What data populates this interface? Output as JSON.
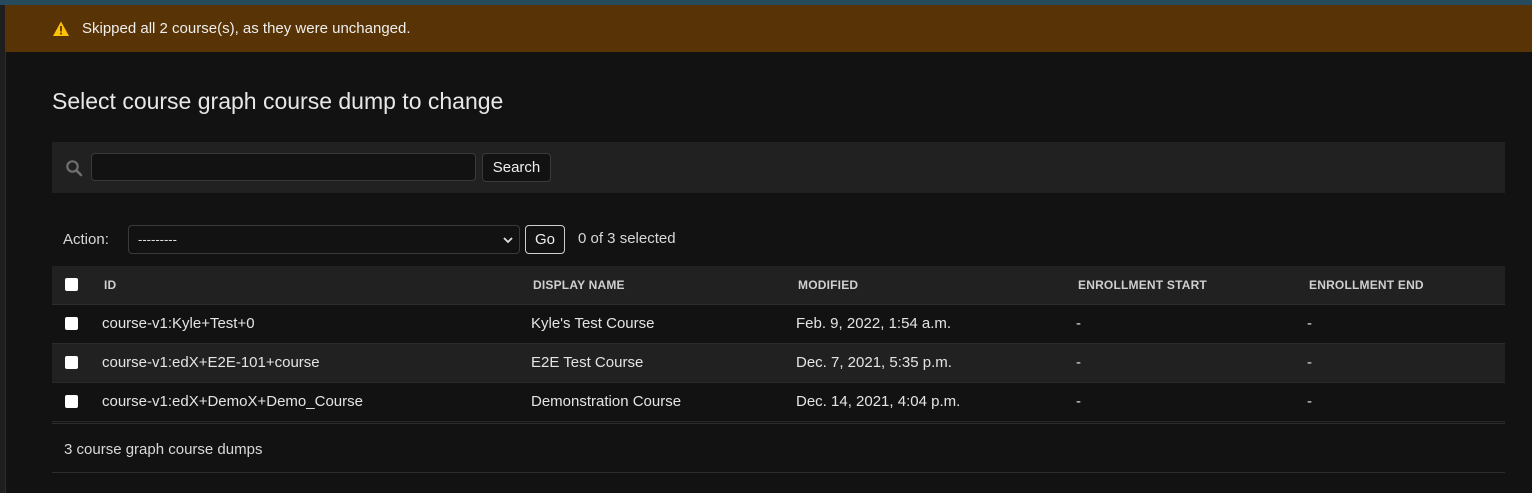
{
  "messages": {
    "warning_text": "Skipped all 2 course(s), as they were unchanged."
  },
  "page": {
    "title": "Select course graph course dump to change"
  },
  "search": {
    "value": "",
    "placeholder": "",
    "button_label": "Search"
  },
  "actions": {
    "label": "Action:",
    "selected_option": "---------",
    "go_label": "Go",
    "counter": "0 of 3 selected"
  },
  "table": {
    "columns": [
      "ID",
      "DISPLAY NAME",
      "MODIFIED",
      "ENROLLMENT START",
      "ENROLLMENT END"
    ],
    "rows": [
      {
        "id": "course-v1:Kyle+Test+0",
        "display_name": "Kyle's Test Course",
        "modified": "Feb. 9, 2022, 1:54 a.m.",
        "enrollment_start": "-",
        "enrollment_end": "-"
      },
      {
        "id": "course-v1:edX+E2E-101+course",
        "display_name": "E2E Test Course",
        "modified": "Dec. 7, 2021, 5:35 p.m.",
        "enrollment_start": "-",
        "enrollment_end": "-"
      },
      {
        "id": "course-v1:edX+DemoX+Demo_Course",
        "display_name": "Demonstration Course",
        "modified": "Dec. 14, 2021, 4:04 p.m.",
        "enrollment_start": "-",
        "enrollment_end": "-"
      }
    ]
  },
  "footer": {
    "result_count": "3 course graph course dumps"
  },
  "colors": {
    "warning_background": "#583305",
    "warning_icon": "#ffc107",
    "page_background": "#121212",
    "panel_background": "#212121"
  },
  "icons": {
    "warning": "warning-icon",
    "search": "search-icon",
    "select_chevron": "chevron-down-icon"
  }
}
